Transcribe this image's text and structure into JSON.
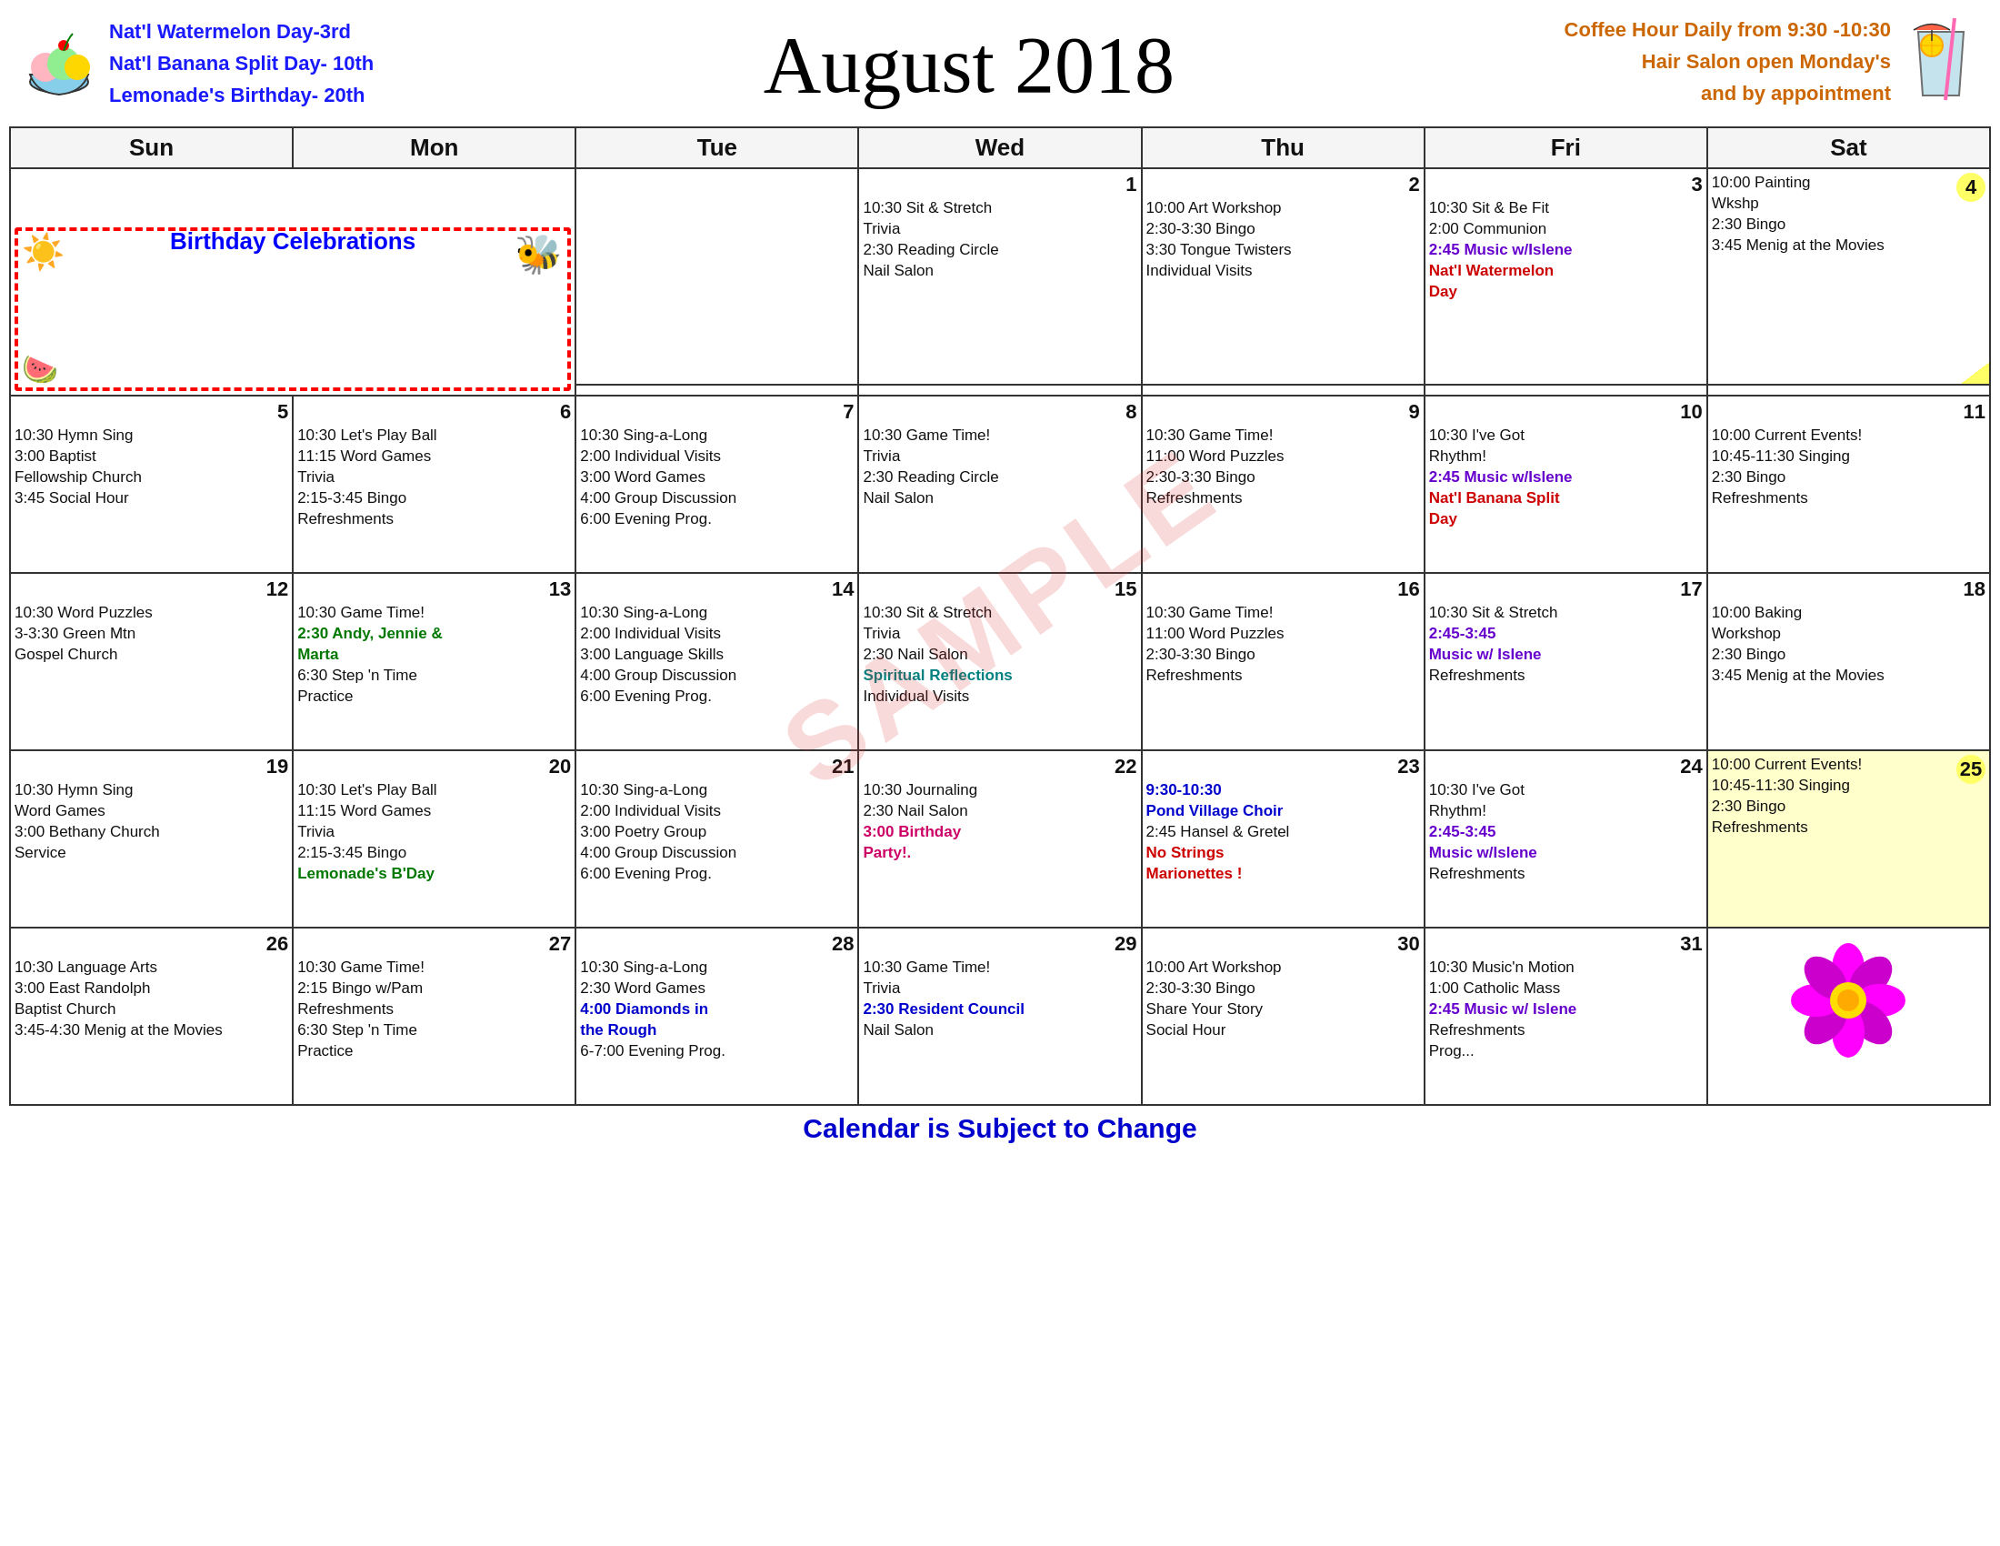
{
  "header": {
    "title": "August 2018",
    "left_text_line1": "Nat'l Watermelon Day-3rd",
    "left_text_line2": "Nat'l Banana Split Day- 10th",
    "left_text_line3": "Lemonade's Birthday- 20th",
    "right_text_line1": "Coffee Hour Daily from 9:30 -10:30",
    "right_text_line2": "Hair Salon open Monday's",
    "right_text_line3": "and by appointment"
  },
  "days_of_week": [
    "Sun",
    "Mon",
    "Tue",
    "Wed",
    "Thu",
    "Fri",
    "Sat"
  ],
  "footer": "Calendar is Subject to Change",
  "watermark": "SAMPLE"
}
